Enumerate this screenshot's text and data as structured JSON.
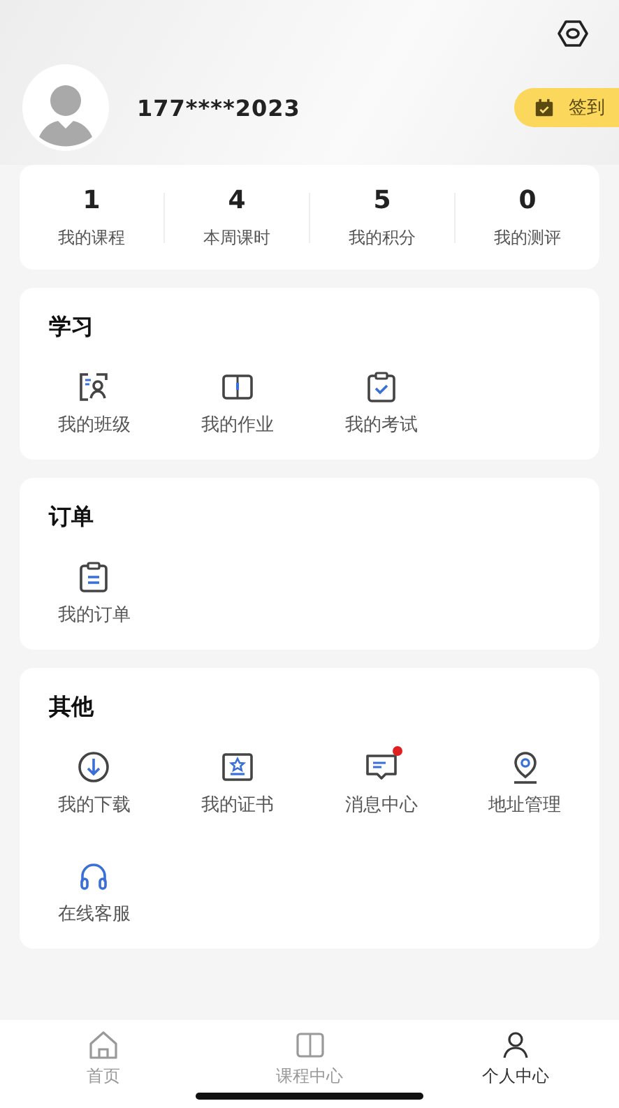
{
  "header": {
    "phone": "177****2023",
    "checkin_button": "签到"
  },
  "stats": [
    {
      "value": "1",
      "label": "我的课程"
    },
    {
      "value": "4",
      "label": "本周课时"
    },
    {
      "value": "5",
      "label": "我的积分"
    },
    {
      "value": "0",
      "label": "我的测评"
    }
  ],
  "sections": [
    {
      "title": "学习",
      "items": [
        {
          "label": "我的班级",
          "badge": false
        },
        {
          "label": "我的作业",
          "badge": false
        },
        {
          "label": "我的考试",
          "badge": false
        }
      ]
    },
    {
      "title": "订单",
      "items": [
        {
          "label": "我的订单",
          "badge": false
        }
      ]
    },
    {
      "title": "其他",
      "items": [
        {
          "label": "我的下载",
          "badge": false
        },
        {
          "label": "我的证书",
          "badge": false
        },
        {
          "label": "消息中心",
          "badge": true
        },
        {
          "label": "地址管理",
          "badge": false
        },
        {
          "label": "在线客服",
          "badge": false
        }
      ]
    }
  ],
  "tab_bar": [
    {
      "label": "首页",
      "selected": false
    },
    {
      "label": "课程中心",
      "selected": false
    },
    {
      "label": "个人中心",
      "selected": true
    }
  ]
}
